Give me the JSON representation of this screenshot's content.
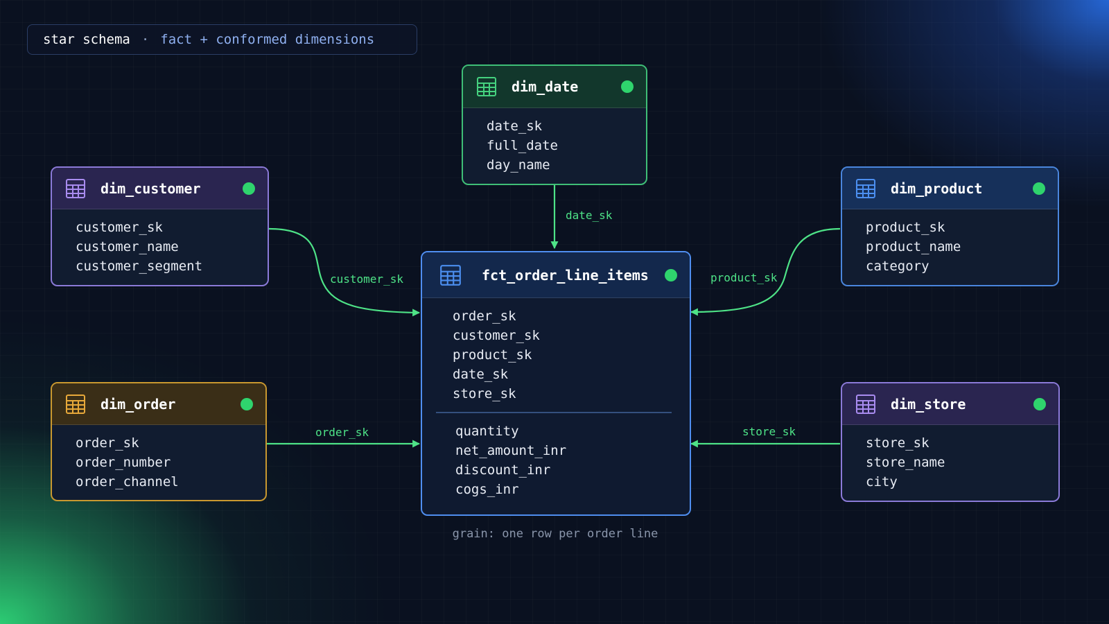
{
  "header": {
    "title": "star schema",
    "separator": "·",
    "subtitle": "fact + conformed dimensions"
  },
  "colors": {
    "edge": "#4ee387",
    "status_dot": "#2fd46d",
    "fact_border": "#4f8ef0",
    "customer_border": "#8b7ad8",
    "date_border": "#3fbf77",
    "product_border": "#4a86dd",
    "order_border": "#c9982f",
    "store_border": "#8b7ad8"
  },
  "tables": {
    "dim_date": {
      "name": "dim_date",
      "icon": "table-grid-icon",
      "fields": [
        "date_sk",
        "full_date",
        "day_name"
      ]
    },
    "dim_customer": {
      "name": "dim_customer",
      "icon": "table-grid-icon",
      "fields": [
        "customer_sk",
        "customer_name",
        "customer_segment"
      ]
    },
    "dim_product": {
      "name": "dim_product",
      "icon": "table-grid-icon",
      "fields": [
        "product_sk",
        "product_name",
        "category"
      ]
    },
    "dim_order": {
      "name": "dim_order",
      "icon": "table-grid-icon",
      "fields": [
        "order_sk",
        "order_number",
        "order_channel"
      ]
    },
    "dim_store": {
      "name": "dim_store",
      "icon": "table-grid-icon",
      "fields": [
        "store_sk",
        "store_name",
        "city"
      ]
    },
    "fact": {
      "name": "fct_order_line_items",
      "icon": "table-grid-icon",
      "keys": [
        "order_sk",
        "customer_sk",
        "product_sk",
        "date_sk",
        "store_sk"
      ],
      "measures": [
        "quantity",
        "net_amount_inr",
        "discount_inr",
        "cogs_inr"
      ]
    }
  },
  "edges": {
    "date": "date_sk",
    "customer": "customer_sk",
    "product": "product_sk",
    "order": "order_sk",
    "store": "store_sk"
  },
  "grain": "grain: one row per order line"
}
